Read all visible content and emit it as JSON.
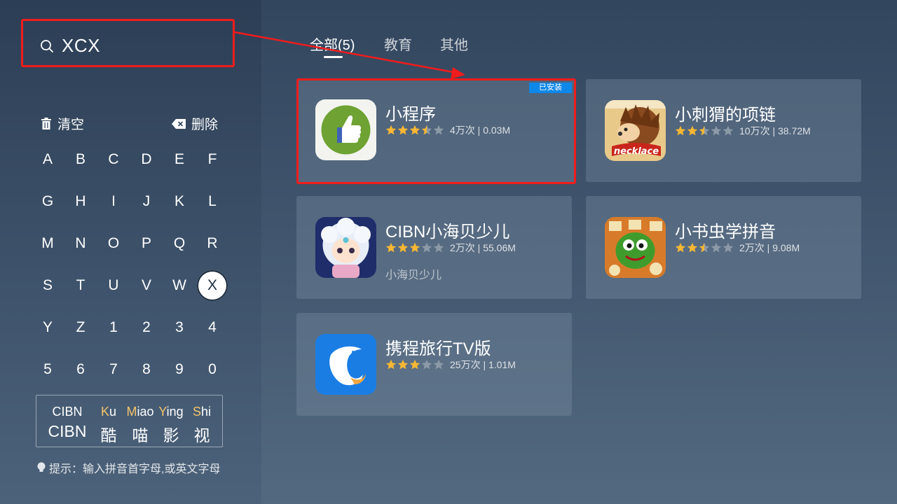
{
  "search": {
    "query": "XCX"
  },
  "keyboard": {
    "clear_label": "清空",
    "delete_label": "删除",
    "rows": [
      [
        "A",
        "B",
        "C",
        "D",
        "E",
        "F"
      ],
      [
        "G",
        "H",
        "I",
        "J",
        "K",
        "L"
      ],
      [
        "M",
        "N",
        "O",
        "P",
        "Q",
        "R"
      ],
      [
        "S",
        "T",
        "U",
        "V",
        "W",
        "X"
      ],
      [
        "Y",
        "Z",
        "1",
        "2",
        "3",
        "4"
      ],
      [
        "5",
        "6",
        "7",
        "8",
        "9",
        "0"
      ]
    ],
    "selected_key": "X"
  },
  "suggestions": [
    {
      "pinyin_hl": "",
      "pinyin_rest": "CIBN",
      "hanzi": "CIBN"
    },
    {
      "pinyin_hl": "K",
      "pinyin_rest": "u",
      "hanzi": "酷"
    },
    {
      "pinyin_hl": "M",
      "pinyin_rest": "iao",
      "hanzi": "喵"
    },
    {
      "pinyin_hl": "Y",
      "pinyin_rest": "ing",
      "hanzi": "影"
    },
    {
      "pinyin_hl": "S",
      "pinyin_rest": "hi",
      "hanzi": "视"
    }
  ],
  "hint": "提示：输入拼音首字母,或英文字母",
  "tabs": [
    {
      "label": "全部(5)",
      "active": true
    },
    {
      "label": "教育",
      "active": false
    },
    {
      "label": "其他",
      "active": false
    }
  ],
  "apps": [
    {
      "name": "小程序",
      "rating": 3.5,
      "stats": "4万次 | 0.03M",
      "badge": "已安装",
      "subtitle": "",
      "icon": "thumbs-up-icon",
      "highlight": true
    },
    {
      "name": "小刺猬的项链",
      "rating": 2.5,
      "stats": "10万次 | 38.72M",
      "badge": "",
      "subtitle": "",
      "icon": "hedgehog-icon",
      "icon_text": "necklace",
      "highlight": false
    },
    {
      "name": "CIBN小海贝少儿",
      "rating": 3,
      "stats": "2万次 | 55.06M",
      "badge": "",
      "subtitle": "小海贝少儿",
      "icon": "cartoon-girl-icon",
      "highlight": false
    },
    {
      "name": "小书虫学拼音",
      "rating": 2.5,
      "stats": "2万次 | 9.08M",
      "badge": "",
      "subtitle": "",
      "icon": "bookworm-icon",
      "highlight": false
    },
    {
      "name": "携程旅行TV版",
      "rating": 3,
      "stats": "25万次 | 1.01M",
      "badge": "",
      "subtitle": "",
      "icon": "dolphin-icon",
      "highlight": false
    }
  ],
  "colors": {
    "highlight_border": "#f11c1c",
    "badge_bg": "#0d87e8",
    "star_filled": "#f7b733",
    "star_empty": "#8c9aa8",
    "pinyin_highlight": "#f5c46a"
  }
}
